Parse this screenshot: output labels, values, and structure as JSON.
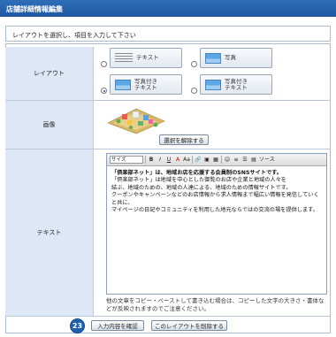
{
  "window": {
    "title": "店舗詳細情報編集"
  },
  "instruction": "レイアウトを選択し、項目を入力して下さい",
  "layout": {
    "label": "レイアウト",
    "options": [
      {
        "label": "テキスト",
        "selected": false
      },
      {
        "label": "写真",
        "selected": false
      },
      {
        "label": "写真付き\nテキスト",
        "selected": true
      },
      {
        "label": "写真付き\nテキスト",
        "selected": false
      }
    ]
  },
  "image": {
    "label": "画像",
    "cancel_button": "選択を解除する"
  },
  "text": {
    "label": "テキスト",
    "toolbar": {
      "size_select": "サイズ",
      "buttons": [
        "B",
        "I",
        "U",
        "A",
        "Aa",
        "ソース"
      ]
    },
    "body_lines": [
      "「倶楽部ネット」は、地域お店を応援する会員制のSNSサイトです。",
      "「倶楽部ネット」は地域を中心とした御覧のお店や企業と地域の人々を",
      "結ぶ、地域のための、地域の人達による、地域のための情報サイトです。",
      "クーポンやキャンペーンなどのお店情報から求人情報まで幅広い情報を発信していくと共に、",
      "マイページの日記やコミュニティを利用した地元ならではの交流の場を提供します。"
    ],
    "note": "他の文章をコピー・ペーストして書き込む場合は、コピーした文字の大きさ・書体などが反映されますのでご注意ください。"
  },
  "footer": {
    "badge": "23",
    "confirm_button": "入力内容を確認",
    "delete_button": "このレイアウトを削除する"
  }
}
